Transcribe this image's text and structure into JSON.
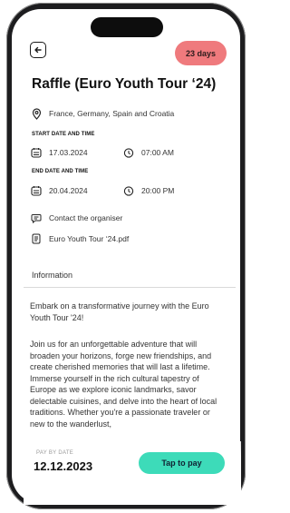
{
  "header": {
    "badge_label": "23 days"
  },
  "event": {
    "title": "Raffle (Euro Youth Tour ‘24)",
    "location": "France, Germany, Spain and Croatia",
    "start_label": "START DATE AND TIME",
    "start_date": "17.03.2024",
    "start_time": "07:00 AM",
    "end_label": "END DATE AND TIME",
    "end_date": "20.04.2024",
    "end_time": "20:00 PM",
    "contact_label": "Contact the organiser",
    "document_label": "Euro Youth Tour ‘24.pdf"
  },
  "info": {
    "section_title": "Information",
    "paragraph_1": "Embark on a transformative journey with the Euro Youth Tour '24!",
    "paragraph_2": "Join us for an unforgettable adventure that will broaden your horizons, forge new friendships, and create cherished memories that will last a lifetime. Immerse yourself in the rich cultural tapestry of Europe as we explore iconic landmarks, savor delectable cuisines, and delve into the heart of local traditions. Whether you're a passionate traveler or new to the wanderlust,"
  },
  "footer": {
    "pay_by_label": "PAY BY DATE",
    "pay_by_date": "12.12.2023",
    "pay_button_label": "Tap to pay"
  },
  "colors": {
    "badge": "#ef7a7d",
    "pay_button": "#3ddbb9"
  },
  "icons": [
    "back-icon",
    "location-pin-icon",
    "calendar-icon",
    "clock-icon",
    "chat-icon",
    "document-icon"
  ]
}
